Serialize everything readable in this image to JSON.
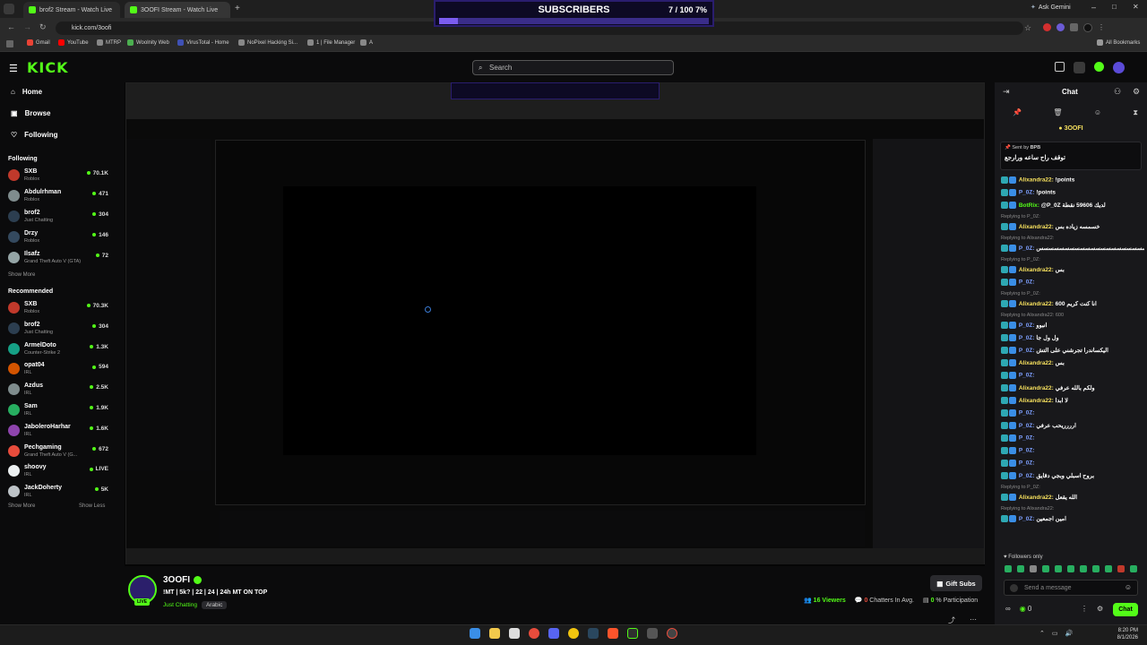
{
  "browser": {
    "tabs": [
      {
        "label": "brof2 Stream - Watch Live"
      },
      {
        "label": "3OOFI Stream - Watch Live"
      }
    ],
    "url": "kick.com/3oofi",
    "ask_gemini": "Ask Gemini",
    "bookmarks": [
      "Gmail",
      "YouTube",
      "MTRP",
      "Woolnity Web",
      "VirusTotal - Home",
      "NoPixel Hacking Si...",
      "1 | File Manager",
      "A"
    ],
    "all_bookmarks": "All Bookmarks"
  },
  "overlay": {
    "title": "SUBSCRIBERS",
    "count": "7 / 100",
    "percent_label": "7%",
    "fill_percent": 7
  },
  "header": {
    "logo": "KICK",
    "search_placeholder": "Search"
  },
  "sidebar": {
    "nav": [
      {
        "label": "Home"
      },
      {
        "label": "Browse"
      },
      {
        "label": "Following"
      }
    ],
    "following_title": "Following",
    "following": [
      {
        "name": "SXB",
        "game": "Roblox",
        "viewers": "70.1K",
        "color": "#c0392b"
      },
      {
        "name": "Abdulrhman",
        "game": "Roblox",
        "viewers": "471",
        "color": "#7f8c8d"
      },
      {
        "name": "brof2",
        "game": "Just Chatting",
        "viewers": "304",
        "color": "#2c3e50"
      },
      {
        "name": "Drzy",
        "game": "Roblox",
        "viewers": "146",
        "color": "#34495e"
      },
      {
        "name": "Ilsafz",
        "game": "Grand Theft Auto V (GTA)",
        "viewers": "72",
        "color": "#95a5a6"
      }
    ],
    "show_more": "Show More",
    "recommended_title": "Recommended",
    "recommended": [
      {
        "name": "SXB",
        "game": "Roblox",
        "viewers": "70.3K",
        "color": "#c0392b"
      },
      {
        "name": "brof2",
        "game": "Just Chatting",
        "viewers": "304",
        "color": "#2c3e50"
      },
      {
        "name": "ArmelDoto",
        "game": "Counter-Strike 2",
        "viewers": "1.3K",
        "color": "#16a085"
      },
      {
        "name": "opat04",
        "game": "IRL",
        "viewers": "594",
        "color": "#d35400"
      },
      {
        "name": "Azdus",
        "game": "IRL",
        "viewers": "2.5K",
        "color": "#7f8c8d"
      },
      {
        "name": "Sam",
        "game": "IRL",
        "viewers": "1.9K",
        "color": "#27ae60"
      },
      {
        "name": "JaboleroHarhar",
        "game": "IRL",
        "viewers": "1.6K",
        "color": "#8e44ad"
      },
      {
        "name": "Pechgaming",
        "game": "Grand Theft Auto V (G...",
        "viewers": "672",
        "color": "#e74c3c"
      },
      {
        "name": "shoovy",
        "game": "IRL",
        "viewers": "LIVE",
        "color": "#ecf0f1"
      },
      {
        "name": "JackDoherty",
        "game": "IRL",
        "viewers": "5K",
        "color": "#bdc3c7"
      }
    ],
    "show_more_2": "Show More",
    "show_less": "Show Less"
  },
  "stream": {
    "name": "3OOFI",
    "title": "!MT | 5k? | 22 | 24 | 24h MT ON TOP",
    "category": "Just Chatting",
    "tag": "Arabic",
    "live": "LIVE",
    "gift_subs": "Gift Subs",
    "viewers": "16",
    "viewers_label": "Viewers",
    "chatters": "0",
    "chatters_label": "Chatters In Avg.",
    "participation": "0",
    "participation_label": "% Participation"
  },
  "chat": {
    "title": "Chat",
    "pinned_header": "3OOFI",
    "pinned_sender": "Sent by",
    "pinned_user": "BPB",
    "pinned_text": "توقف راح ساعه ورارجع",
    "messages": [
      {
        "reply": "",
        "user": "Alixandra22:",
        "text": "!points",
        "cls": "user"
      },
      {
        "reply": "",
        "user": "P_0Z:",
        "text": "!points",
        "cls": "user2"
      },
      {
        "reply": "",
        "user": "BotRix:",
        "text": "@P_0Z لديك 59606 نقطة",
        "cls": "user3"
      },
      {
        "reply": "Replying to P_0Z:",
        "user": "Alixandra22:",
        "text": "خسمسه زياده بس",
        "cls": "user"
      },
      {
        "reply": "Replying to Alixandra22:",
        "user": "P_0Z:",
        "text": "سسسسسسسسسسسسسسسسسسسسسس",
        "cls": "user2"
      },
      {
        "reply": "Replying to P_0Z:",
        "user": "Alixandra22:",
        "text": "بس",
        "cls": "user"
      },
      {
        "reply": "",
        "user": "P_0Z:",
        "text": "",
        "cls": "user2"
      },
      {
        "reply": "Replying to P_0Z:",
        "user": "Alixandra22:",
        "text": "انا كنت كريم 600",
        "cls": "user"
      },
      {
        "reply": "Replying to Alixandra22: 600",
        "user": "P_0Z:",
        "text": "انبوو",
        "cls": "user2"
      },
      {
        "reply": "",
        "user": "P_0Z:",
        "text": "ول ول جا",
        "cls": "user2"
      },
      {
        "reply": "",
        "user": "P_0Z:",
        "text": "اليكساندرا تجرشني على التش",
        "cls": "user2"
      },
      {
        "reply": "",
        "user": "Alixandra22:",
        "text": "بس",
        "cls": "user"
      },
      {
        "reply": "",
        "user": "P_0Z:",
        "text": "",
        "cls": "user2"
      },
      {
        "reply": "",
        "user": "Alixandra22:",
        "text": "ولكم بالله عرفي",
        "cls": "user"
      },
      {
        "reply": "",
        "user": "Alixandra22:",
        "text": "لا ابدا",
        "cls": "user"
      },
      {
        "reply": "",
        "user": "P_0Z:",
        "text": "",
        "cls": "user2"
      },
      {
        "reply": "",
        "user": "P_0Z:",
        "text": "ارررريحب عرفي",
        "cls": "user2"
      },
      {
        "reply": "",
        "user": "P_0Z:",
        "text": "",
        "cls": "user2"
      },
      {
        "reply": "",
        "user": "P_0Z:",
        "text": "",
        "cls": "user2"
      },
      {
        "reply": "",
        "user": "P_0Z:",
        "text": "",
        "cls": "user2"
      },
      {
        "reply": "",
        "user": "P_0Z:",
        "text": "بروح اسبلي وبجي دقايق",
        "cls": "user2"
      },
      {
        "reply": "Replying to P_0Z:",
        "user": "Alixandra22:",
        "text": "الله يقعل",
        "cls": "user"
      },
      {
        "reply": "Replying to Alixandra22:",
        "user": "P_0Z:",
        "text": "امين اجمعين",
        "cls": "user2"
      }
    ],
    "followers_only": "Followers only",
    "send_placeholder": "Send a message",
    "points": "0",
    "chat_button": "Chat"
  },
  "taskbar": {
    "time": "8:20 PM",
    "date": "8/1/2026"
  }
}
